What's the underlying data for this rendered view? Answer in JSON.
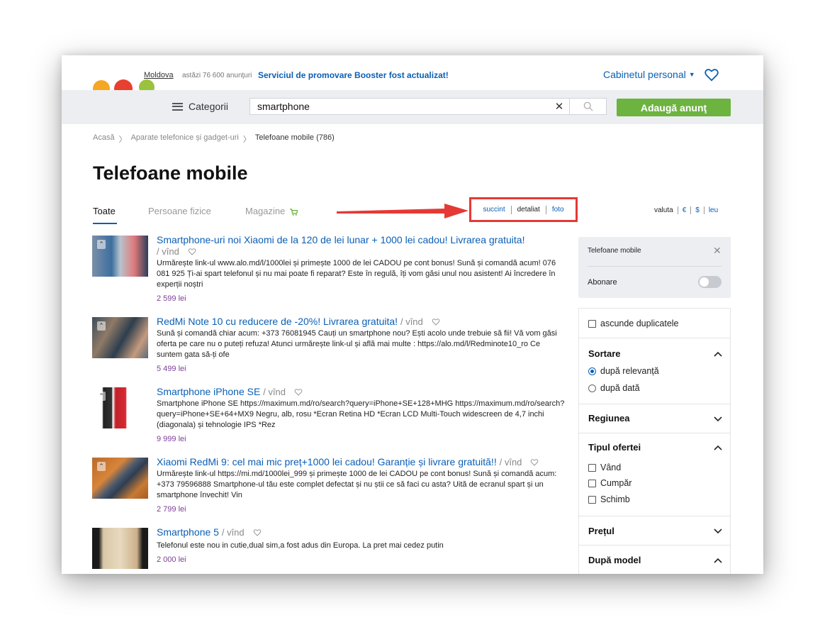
{
  "topbar": {
    "location": "Moldova",
    "count": "astăzi 76 600 anunţuri",
    "promo": "Serviciul de promovare Booster fost actualizat!",
    "cabinet": "Cabinetul personal"
  },
  "header": {
    "categories": "Categorii",
    "search_value": "smartphone",
    "clear": "✕",
    "add_button": "Adaugă anunţ"
  },
  "breadcrumb": [
    "Acasă",
    "Aparate telefonice și gadget-uri",
    "Telefoane mobile (786)"
  ],
  "breadcrumb_sep": "〉",
  "page_title": "Telefoane mobile",
  "tabs": [
    "Toate",
    "Persoane fizice",
    "Magazine"
  ],
  "view_modes": {
    "succinct": "succint",
    "detailed": "detaliat",
    "photo": "foto"
  },
  "currency": {
    "label": "valuta",
    "eur": "€",
    "usd": "$",
    "leu": "leu"
  },
  "listings": [
    {
      "title": "Smartphone-uri noi Xiaomi de la 120 de lei lunar + 1000 lei cadou! Livrarea gratuita!",
      "tag": "/ vînd",
      "desc": "Urmărește link-ul www.alo.md/l/1000lei și primește 1000 de lei CADOU pe cont bonus! Sună și comandă acum! 076 081 925 Ți-ai spart telefonul și nu mai poate fi reparat? Este în regulă, îți vom găsi unul nou asistent! Ai încredere în experții noștri",
      "price": "2 599 lei"
    },
    {
      "title": "RedMi Note 10 cu reducere de -20%! Livrarea gratuita!",
      "tag": "/ vînd",
      "desc": "Sună și comandă chiar acum: +373 76081945 Cauți un smartphone nou? Ești acolo unde trebuie să fii! Vă vom găsi oferta pe care nu o puteți refuza! Atunci urmărește link-ul și află mai multe : https://alo.md/l/Redminote10_ro Ce suntem gata să-ți ofe",
      "price": "5 499 lei"
    },
    {
      "title": "Smartphone iPhone SE",
      "tag": "/ vînd",
      "desc": "Smartphone iPhone SE https://maximum.md/ro/search?query=iPhone+SE+128+MHG https://maximum.md/ro/search?query=iPhone+SE+64+MX9 Negru, alb, rosu *Ecran Retina HD *Ecran LCD Multi-Touch widescreen de 4,7 inchi (diagonala) și tehnologie IPS *Rez",
      "price": "9 999 lei"
    },
    {
      "title": "Xiaomi RedMi 9: cel mai mic preț+1000 lei cadou! Garanție și livrare gratuită!!",
      "tag": "/ vînd",
      "desc": "Urmărește link-ul https://mi.md/1000lei_999 și primește 1000 de lei CADOU pe cont bonus! Sună și comandă acum: +373 79596888 Smartphone-ul tău este complet defectat și nu știi ce să faci cu asta? Uită de ecranul spart și un smartphone învechit! Vin",
      "price": "2 799 lei"
    },
    {
      "title": "Smartphone 5",
      "tag": "/ vînd",
      "desc": "Telefonul este nou in cutie,dual sim,a fost adus din Europa. La pret mai cedez putin",
      "price": "2 000 lei"
    }
  ],
  "sidebar": {
    "filter_title": "Telefoane mobile",
    "close": "✕",
    "subscribe": "Abonare",
    "hide_duplicates": "ascunde duplicatele",
    "sort_title": "Sortare",
    "sort_options": [
      "după relevanță",
      "după dată"
    ],
    "region": "Regiunea",
    "offer_type": "Tipul ofertei",
    "offer_options": [
      "Vând",
      "Cumpăr",
      "Schimb"
    ],
    "price": "Prețul",
    "model": "După model"
  },
  "colors": {
    "accent": "#0a5fb5",
    "green": "#6db33f",
    "red": "#e53935",
    "price": "#7b3f98"
  }
}
